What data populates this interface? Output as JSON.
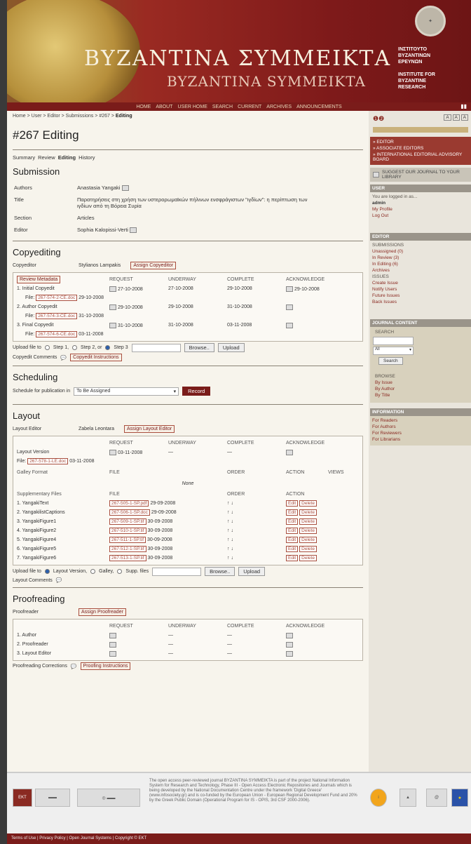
{
  "header": {
    "title_gr": "ΒΥΖΑΝΤΙΝΑ ΣΥΜΜΕΙΚΤΑ",
    "title_lat": "BYZANTINA SYMMEIKTA",
    "inst_gr": "ΙΝΣΤΙΤΟΥΤΟ\nΒΥΖΑΝΤΙΝΩΝ\nΕΡΕΥΝΩΝ",
    "inst_en": "INSTITUTE FOR\nBYZANTINE\nRESEARCH"
  },
  "nav": [
    "HOME",
    "ABOUT",
    "USER HOME",
    "SEARCH",
    "CURRENT",
    "ARCHIVES",
    "ANNOUNCEMENTS"
  ],
  "breadcrumb": {
    "path": "Home > User > Editor > Submissions > #267 >",
    "current": "Editing"
  },
  "page_title": "#267 Editing",
  "subtabs": [
    "Summary",
    "Review",
    "Editing",
    "History"
  ],
  "submission": {
    "heading": "Submission",
    "rows": [
      {
        "label": "Authors",
        "value": "Anastasia Yangaki"
      },
      {
        "label": "Title",
        "value": "Παρατηρήσεις στη χρήση των υστερορωμαϊκών πήλινων ενσφράγιστων \"ιγδίων\": η περίπτωση των ιγδίων από τη Βόρεια Συρία"
      },
      {
        "label": "Section",
        "value": "Articles"
      },
      {
        "label": "Editor",
        "value": "Sophia Kalopissi-Verti"
      }
    ]
  },
  "copyediting": {
    "heading": "Copyediting",
    "copyeditor_label": "Copyeditor",
    "copyeditor": "Stylianos Lampakis",
    "assign": "Assign Copyeditor",
    "review_meta": "Review Metadata",
    "cols": [
      "REQUEST",
      "UNDERWAY",
      "COMPLETE",
      "ACKNOWLEDGE"
    ],
    "steps": [
      {
        "name": "1. Initial Copyedit",
        "request": "27-10-2008",
        "underway": "27-10-2008",
        "complete": "29-10-2008",
        "ack": "29-10-2008",
        "file": "267-574-2-CE.doc",
        "file_date": "29-10-2008"
      },
      {
        "name": "2. Author Copyedit",
        "request": "29-10-2008",
        "underway": "29-10-2008",
        "complete": "31-10-2008",
        "ack": "",
        "file": "267-574-3-CE.doc",
        "file_date": "31-10-2008"
      },
      {
        "name": "3. Final Copyedit",
        "request": "31-10-2008",
        "underway": "31-10-2008",
        "complete": "03-11-2008",
        "ack": "",
        "file": "267-574-6-CE.doc",
        "file_date": "03-11-2008"
      }
    ],
    "file_label": "File:",
    "upload_label": "Upload file to",
    "step1": "Step 1,",
    "step2": "Step 2, or",
    "step3": "Step 3",
    "browse": "Browse..",
    "upload": "Upload",
    "comments": "Copyedit Comments",
    "instructions": "Copyedit Instructions"
  },
  "scheduling": {
    "heading": "Scheduling",
    "label": "Schedule for publication in",
    "value": "To Be Assigned",
    "record": "Record"
  },
  "layout": {
    "heading": "Layout",
    "editor_label": "Layout Editor",
    "editor": "Zabela Leontara",
    "assign": "Assign Layout Editor",
    "cols": [
      "REQUEST",
      "UNDERWAY",
      "COMPLETE",
      "ACKNOWLEDGE"
    ],
    "version_label": "Layout Version",
    "version_request": "03-11-2008",
    "version_underway": "—",
    "version_complete": "—",
    "file_label": "File:",
    "file": "267-578-1-LE.doc",
    "file_date": "03-11-2008",
    "galley_label": "Galley Format",
    "galley_cols": [
      "FILE",
      "ORDER",
      "ACTION",
      "VIEWS"
    ],
    "none": "None",
    "supp_label": "Supplementary Files",
    "supp_cols": [
      "FILE",
      "ORDER",
      "ACTION"
    ],
    "supp": [
      {
        "name": "1. YangakiText",
        "file": "267-505-1-SP.pdf",
        "date": "29-09-2008"
      },
      {
        "name": "2. YangakilistCaptions",
        "file": "267-506-1-SP.doc",
        "date": "29-09-2008"
      },
      {
        "name": "3. YangakiFigure1",
        "file": "267-509-1-SP.tif",
        "date": "30-09-2008"
      },
      {
        "name": "4. YangakiFigure2",
        "file": "267-510-1-SP.tif",
        "date": "30-09-2008"
      },
      {
        "name": "5. YangakiFigure4",
        "file": "267-511-1-SP.tif",
        "date": "30-09-2008"
      },
      {
        "name": "6. YangakiFigure5",
        "file": "267-512-1-SP.tif",
        "date": "30-09-2008"
      },
      {
        "name": "7. YangakiFigure6",
        "file": "267-513-1-SP.tif",
        "date": "30-09-2008"
      }
    ],
    "order": "↑ ↓",
    "edit": "Edit",
    "delete": "Delete",
    "upload_label": "Upload file to",
    "opt1": "Layout Version,",
    "opt2": "Galley,",
    "opt3": "Supp. files",
    "browse": "Browse..",
    "upload": "Upload",
    "comments": "Layout Comments"
  },
  "proofreading": {
    "heading": "Proofreading",
    "label": "Proofreader",
    "assign": "Assign Proofreader",
    "cols": [
      "REQUEST",
      "UNDERWAY",
      "COMPLETE",
      "ACKNOWLEDGE"
    ],
    "rows": [
      "1. Author",
      "2. Proofreader",
      "3. Layout Editor"
    ],
    "dash": "—",
    "corrections": "Proofreading Corrections",
    "instructions": "Proofing Instructions"
  },
  "sidebar": {
    "font": [
      "A",
      "A",
      "A"
    ],
    "links": [
      "» EDITOR",
      "» ASSOCIATE EDITORS",
      "» INTERNATIONAL EDITORIAL ADVISORY BOARD"
    ],
    "suggest": "SUGGEST OUR JOURNAL TO YOUR LIBRARY",
    "user_title": "USER",
    "logged": "You are logged in as...",
    "username": "admin",
    "profile": "My Profile",
    "logout": "Log Out",
    "editor_title": "EDITOR",
    "submissions": "SUBMISSIONS",
    "sub_items": [
      "Unassigned (0)",
      "In Review (3)",
      "In Editing (6)",
      "Archives"
    ],
    "issues": "ISSUES",
    "issue_items": [
      "Create Issue",
      "Notify Users",
      "Future Issues",
      "Back Issues"
    ],
    "jc_title": "JOURNAL CONTENT",
    "search": "SEARCH",
    "search_sel": "All",
    "search_btn": "Search",
    "browse": "BROWSE",
    "browse_items": [
      "By Issue",
      "By Author",
      "By Title"
    ],
    "info_title": "INFORMATION",
    "info_items": [
      "For Readers",
      "For Authors",
      "For Reviewers",
      "For Librarians"
    ]
  },
  "footer": {
    "text": "The open access peer-reviewed journal BYZANTINA SYMMEIKTA is part of the project National Information System for Research and Technology, Phase III - Open Access Electronic Repositories and Journals which is being developed by the National Documentation Centre under the framework 'Digital Greece' (www.infosociety.gr) and is co-funded by the European Union - European Regional Development Fund and 20% by the Greek Public Domain (Operational Program for IS - OPIS, 3rd CSF 2000-2006).",
    "bar": "Terms of Use | Privacy Policy | Open Journal Systems | Copyright © EKT"
  }
}
